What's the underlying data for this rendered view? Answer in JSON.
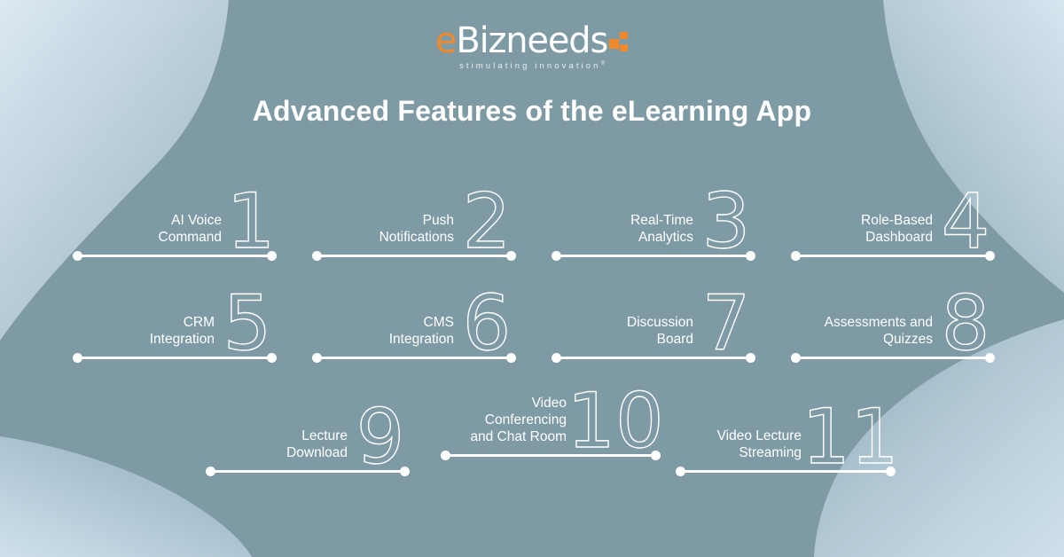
{
  "brand": {
    "logo_e": "e",
    "logo_rest": "Bizneeds",
    "tagline": "stimulating innovation",
    "tagline_mark": "®",
    "accent_color": "#f0892b",
    "logo_text_color": "#ffffff"
  },
  "header": {
    "title": "Advanced Features of the eLearning App"
  },
  "theme": {
    "background_color": "#7d9aa5",
    "blob_color_light": "#cfdeea",
    "blob_color_mid": "#9fb9c4",
    "line_color": "#ffffff",
    "text_color": "#ffffff"
  },
  "features": [
    {
      "number": "1",
      "label": "AI Voice\nCommand"
    },
    {
      "number": "2",
      "label": "Push\nNotifications"
    },
    {
      "number": "3",
      "label": "Real-Time\nAnalytics"
    },
    {
      "number": "4",
      "label": "Role-Based\nDashboard"
    },
    {
      "number": "5",
      "label": "CRM\nIntegration"
    },
    {
      "number": "6",
      "label": "CMS\nIntegration"
    },
    {
      "number": "7",
      "label": "Discussion\nBoard"
    },
    {
      "number": "8",
      "label": "Assessments and\nQuizzes"
    },
    {
      "number": "9",
      "label": "Lecture\nDownload"
    },
    {
      "number": "10",
      "label": "Video\nConferencing\nand Chat Room"
    },
    {
      "number": "11",
      "label": "Video Lecture\nStreaming"
    }
  ]
}
